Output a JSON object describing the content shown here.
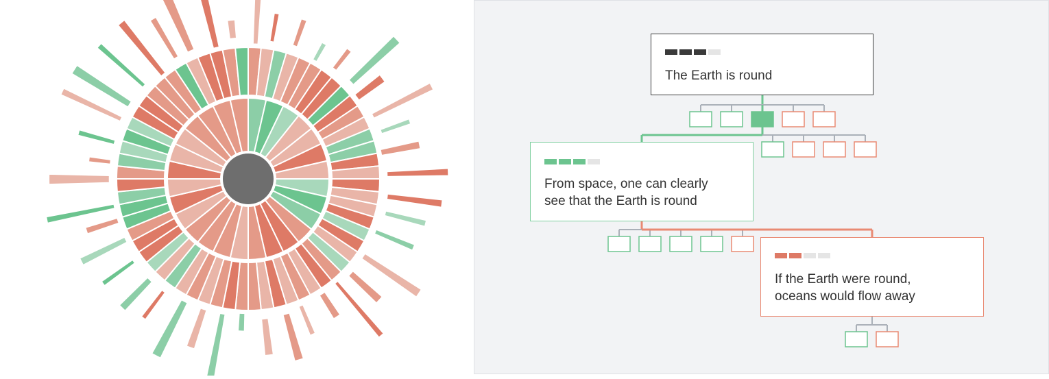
{
  "colors": {
    "agree_light": "#a8d8bb",
    "agree_mid": "#8ccea7",
    "agree_strong": "#6cc48f",
    "disagree_light": "#e9b5a8",
    "disagree_mid": "#e49a88",
    "disagree_strong": "#de7a66",
    "center": "#6e6e6e",
    "claim_border": "#3a3a3a",
    "pro_border": "#7fcf9f",
    "con_border": "#e98a73",
    "connector_gray": "#aab0b8"
  },
  "tree": {
    "claim": {
      "text": "The Earth is round",
      "score_filled": 3,
      "score_total": 4
    },
    "pro": {
      "text": "From space, one can clearly\nsee that the Earth is round",
      "score_filled": 3,
      "score_total": 4
    },
    "con": {
      "text": "If the Earth were round,\noceans would flow away",
      "score_filled": 2,
      "score_total": 4
    }
  }
}
